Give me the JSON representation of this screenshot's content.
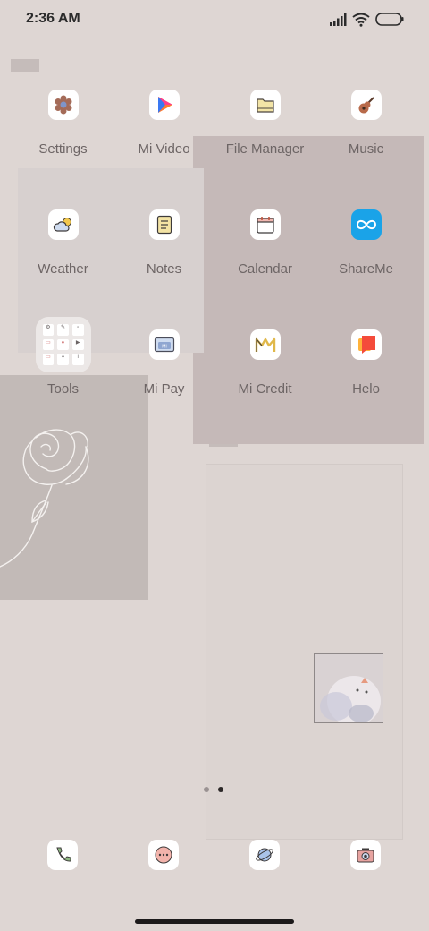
{
  "status_bar": {
    "time": "2:36 AM"
  },
  "apps": [
    {
      "label": "Settings",
      "icon": "settings-icon"
    },
    {
      "label": "Mi Video",
      "icon": "mi-video-icon"
    },
    {
      "label": "File Manager",
      "icon": "file-manager-icon"
    },
    {
      "label": "Music",
      "icon": "music-icon"
    },
    {
      "label": "Weather",
      "icon": "weather-icon"
    },
    {
      "label": "Notes",
      "icon": "notes-icon"
    },
    {
      "label": "Calendar",
      "icon": "calendar-icon"
    },
    {
      "label": "ShareMe",
      "icon": "shareme-icon"
    },
    {
      "label": "Tools",
      "icon": "tools-folder-icon"
    },
    {
      "label": "Mi Pay",
      "icon": "mi-pay-icon"
    },
    {
      "label": "Mi Credit",
      "icon": "mi-credit-icon"
    },
    {
      "label": "Helo",
      "icon": "helo-icon"
    }
  ],
  "dock": [
    {
      "icon": "phone-icon"
    },
    {
      "icon": "messages-icon"
    },
    {
      "icon": "browser-icon"
    },
    {
      "icon": "camera-icon"
    }
  ],
  "page_indicator": {
    "pages": 2,
    "current": 2
  },
  "colors": {
    "background": "#ded6d3",
    "shareme": "#1aa3e8",
    "helo_red": "#f44b3b",
    "helo_orange": "#ffb23a"
  }
}
